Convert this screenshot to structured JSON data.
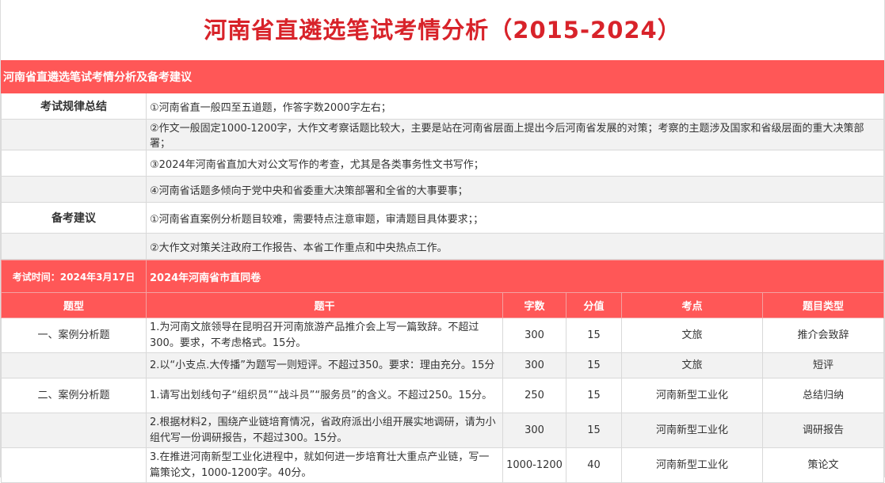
{
  "page_title": "河南省直遴选笔试考情分析（2015-2024）",
  "section_title": "河南省直遴选笔试考情分析及备考建议",
  "rules": {
    "label": "考试规律总结",
    "items": [
      "①河南省直一般四至五道题，作答字数2000字左右；",
      "②作文一般固定1000-1200字，大作文考察话题比较大，主要是站在河南省层面上提出今后河南省发展的对策；考察的主题涉及国家和省级层面的重大决策部署；",
      "③2024年河南省直加大对公文写作的考查，尤其是各类事务性文书写作；",
      "④河南省话题多倾向于党中央和省委重大决策部署和全省的大事要事；"
    ]
  },
  "advice": {
    "label": "备考建议",
    "items": [
      "①河南省直案例分析题目较难，需要特点注意审题，审清题目具体要求；；",
      "②大作文对策关注政府工作报告、本省工作重点和中央热点工作。"
    ]
  },
  "exam": {
    "time_label": "考试时间：2024年3月17日",
    "paper_label": "2024年河南省市直同卷"
  },
  "table": {
    "headers": [
      "题型",
      "题干",
      "字数",
      "分值",
      "考点",
      "题目类型"
    ],
    "rows": [
      {
        "type": "一、案例分析题",
        "stem": "1.为河南文旅领导在昆明召开河南旅游产品推介会上写一篇致辞。不超过300。要求，不考虑格式。15分。",
        "words": "300",
        "score": "15",
        "point": "文旅",
        "qtype": "推介会致辞"
      },
      {
        "type": "",
        "stem": "2.以“小支点.大传播”为题写一则短评。不超过350。要求：理由充分。15分",
        "words": "300",
        "score": "15",
        "point": "文旅",
        "qtype": "短评"
      },
      {
        "type": "二、案例分析题",
        "stem": "1.请写出划线句子“组织员”“战斗员”“服务员”的含义。不超过250。15分。",
        "words": "250",
        "score": "15",
        "point": "河南新型工业化",
        "qtype": "总结归纳"
      },
      {
        "type": "",
        "stem": "2.根据材料2，围绕产业链培育情况，省政府派出小组开展实地调研，请为小组代写一份调研报告，不超过300。15分。",
        "words": "300",
        "score": "15",
        "point": "河南新型工业化",
        "qtype": "调研报告"
      },
      {
        "type": "",
        "stem": "3.在推进河南新型工业化进程中，就如何进一步培育壮大重点产业链，写一篇策论文，1000-1200字。40分。",
        "words": "1000-1200",
        "score": "40",
        "point": "河南新型工业化",
        "qtype": "策论文"
      }
    ]
  },
  "colors": {
    "title_red": "#d8232a",
    "header_red": "#ff5757",
    "zebra_grey": "#f2f2f2"
  }
}
